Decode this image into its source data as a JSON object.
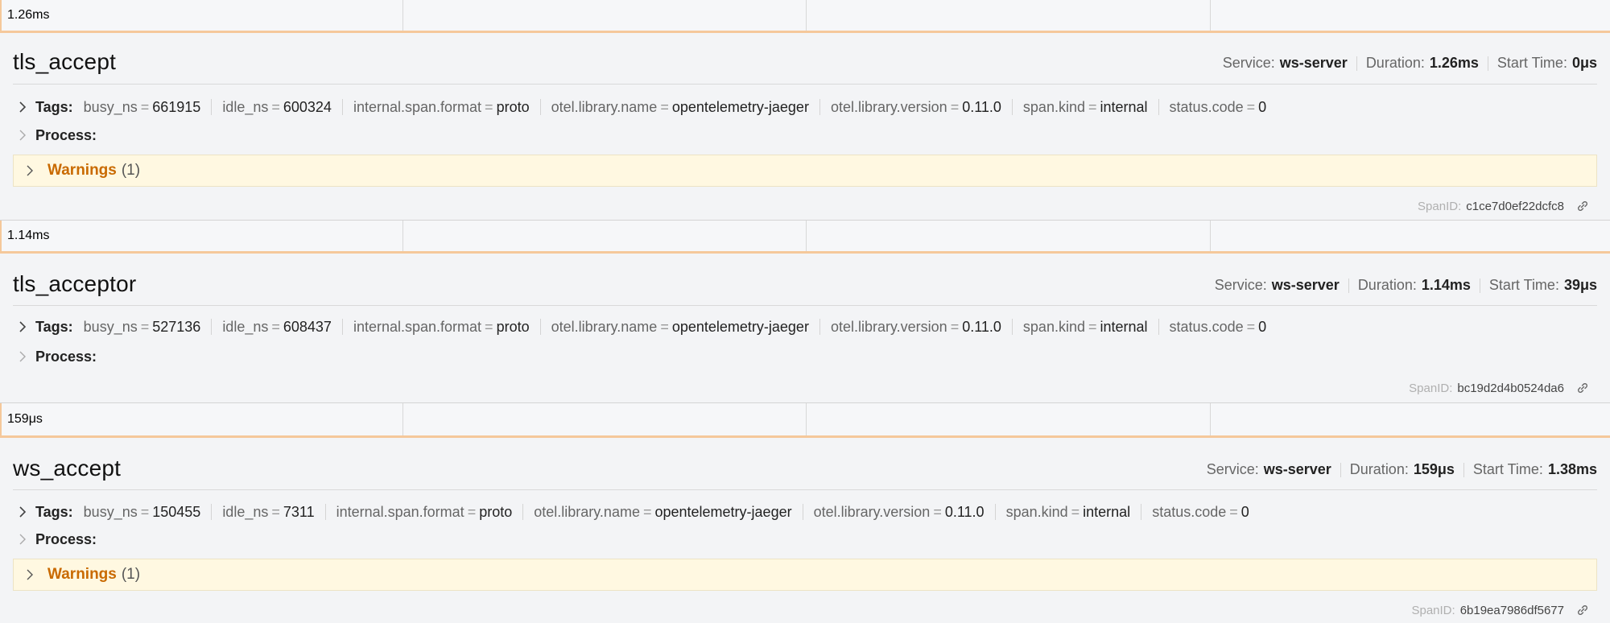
{
  "spans": [
    {
      "duration_label": "1.26ms",
      "name": "tls_accept",
      "service_label": "Service:",
      "service": "ws-server",
      "duration_key": "Duration:",
      "duration": "1.26ms",
      "start_key": "Start Time:",
      "start": "0μs",
      "tags_label": "Tags:",
      "tags": [
        {
          "k": "busy_ns",
          "v": "661915"
        },
        {
          "k": "idle_ns",
          "v": "600324"
        },
        {
          "k": "internal.span.format",
          "v": "proto"
        },
        {
          "k": "otel.library.name",
          "v": "opentelemetry-jaeger"
        },
        {
          "k": "otel.library.version",
          "v": "0.11.0"
        },
        {
          "k": "span.kind",
          "v": "internal"
        },
        {
          "k": "status.code",
          "v": "0"
        }
      ],
      "process_label": "Process:",
      "warnings_label": "Warnings",
      "warnings_count": "(1)",
      "spanid_label": "SpanID:",
      "spanid": "c1ce7d0ef22dcfc8"
    },
    {
      "duration_label": "1.14ms",
      "name": "tls_acceptor",
      "service_label": "Service:",
      "service": "ws-server",
      "duration_key": "Duration:",
      "duration": "1.14ms",
      "start_key": "Start Time:",
      "start": "39μs",
      "tags_label": "Tags:",
      "tags": [
        {
          "k": "busy_ns",
          "v": "527136"
        },
        {
          "k": "idle_ns",
          "v": "608437"
        },
        {
          "k": "internal.span.format",
          "v": "proto"
        },
        {
          "k": "otel.library.name",
          "v": "opentelemetry-jaeger"
        },
        {
          "k": "otel.library.version",
          "v": "0.11.0"
        },
        {
          "k": "span.kind",
          "v": "internal"
        },
        {
          "k": "status.code",
          "v": "0"
        }
      ],
      "process_label": "Process:",
      "spanid_label": "SpanID:",
      "spanid": "bc19d2d4b0524da6"
    },
    {
      "duration_label": "159μs",
      "name": "ws_accept",
      "service_label": "Service:",
      "service": "ws-server",
      "duration_key": "Duration:",
      "duration": "159μs",
      "start_key": "Start Time:",
      "start": "1.38ms",
      "tags_label": "Tags:",
      "tags": [
        {
          "k": "busy_ns",
          "v": "150455"
        },
        {
          "k": "idle_ns",
          "v": "7311"
        },
        {
          "k": "internal.span.format",
          "v": "proto"
        },
        {
          "k": "otel.library.name",
          "v": "opentelemetry-jaeger"
        },
        {
          "k": "otel.library.version",
          "v": "0.11.0"
        },
        {
          "k": "span.kind",
          "v": "internal"
        },
        {
          "k": "status.code",
          "v": "0"
        }
      ],
      "process_label": "Process:",
      "warnings_label": "Warnings",
      "warnings_count": "(1)",
      "spanid_label": "SpanID:",
      "spanid": "6b19ea7986df5677"
    }
  ],
  "colors": {
    "accent_bar": "#f5c89b",
    "warning_text": "#c96a00",
    "warning_bg": "#fff8e1"
  },
  "icons": {
    "expand": "chevron-right-icon",
    "link": "link-icon"
  }
}
